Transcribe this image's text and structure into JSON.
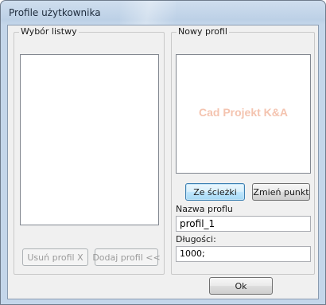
{
  "window": {
    "title": "Profile użytkownika"
  },
  "left_panel": {
    "caption": "Wybór listwy",
    "remove_label": "Usuń profil X",
    "add_label": "Dodaj profil <<"
  },
  "right_panel": {
    "caption": "Nowy profil",
    "preview_watermark": "Cad Projekt K&A",
    "from_path_label": "Ze ścieżki",
    "change_point_label": "Zmień punkt",
    "name_label": "Nazwa proflu",
    "name_value": "profil_1",
    "length_label": "Długości:",
    "length_value": "1000;"
  },
  "footer": {
    "ok_label": "Ok"
  },
  "colors": {
    "watermark": "#f4c4b0",
    "primary_border": "#3c7fb1",
    "dialog_bg": "#f0f0f0",
    "frame": "#c4d6ea"
  }
}
